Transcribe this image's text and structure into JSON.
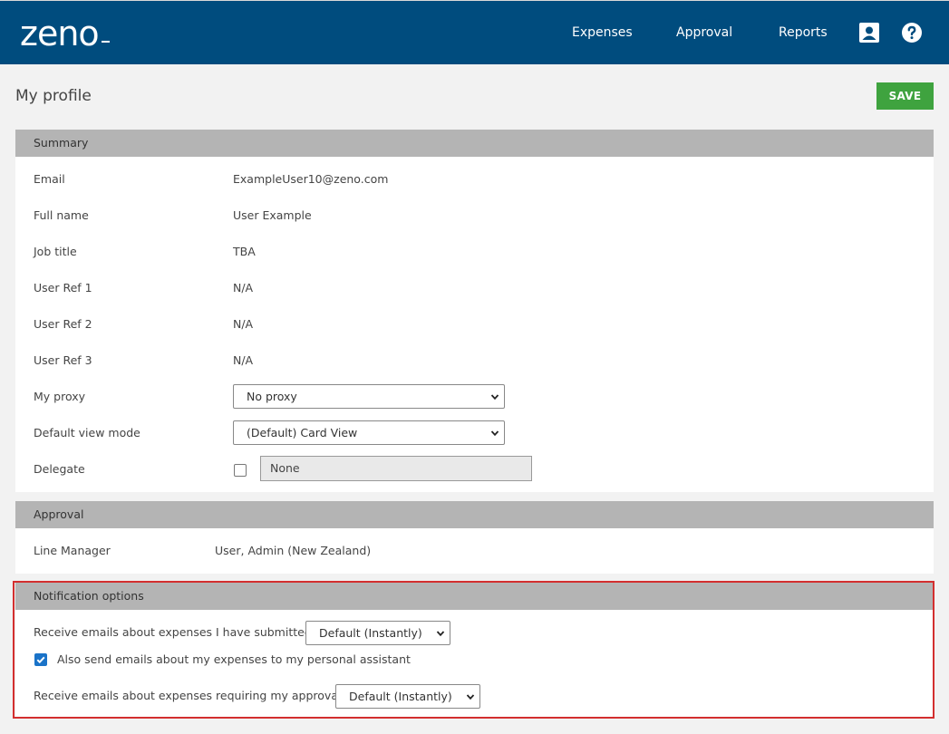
{
  "header": {
    "logo": "zeno",
    "nav": [
      "Expenses",
      "Approval",
      "Reports"
    ],
    "icons": [
      "profile-icon",
      "help-icon"
    ]
  },
  "page": {
    "title": "My profile",
    "save_label": "SAVE"
  },
  "summary": {
    "heading": "Summary",
    "rows": [
      {
        "label": "Email",
        "value": "ExampleUser10@zeno.com"
      },
      {
        "label": "Full name",
        "value": "User Example"
      },
      {
        "label": "Job title",
        "value": "TBA"
      },
      {
        "label": "User Ref 1",
        "value": "N/A"
      },
      {
        "label": "User Ref 2",
        "value": "N/A"
      },
      {
        "label": "User Ref 3",
        "value": "N/A"
      }
    ],
    "proxy": {
      "label": "My proxy",
      "selected": "No proxy"
    },
    "view_mode": {
      "label": "Default view mode",
      "selected": "(Default) Card View"
    },
    "delegate": {
      "label": "Delegate",
      "checked": false,
      "value": "None"
    }
  },
  "approval": {
    "heading": "Approval",
    "line_manager_label": "Line Manager",
    "line_manager_value": "User, Admin (New Zealand)"
  },
  "notifications": {
    "heading": "Notification options",
    "submitted_label": "Receive emails about expenses I have submitted",
    "submitted_selected": "Default (Instantly)",
    "assistant_label": "Also send emails about my expenses to my personal assistant",
    "assistant_checked": true,
    "approval_label": "Receive emails about expenses requiring my approval",
    "approval_selected": "Default (Instantly)"
  },
  "colors": {
    "header_bg": "#004c7e",
    "save_bg": "#3fa33f",
    "section_head_bg": "#b4b4b4",
    "highlight": "#d32f2f",
    "checkbox_checked": "#1a73c8"
  }
}
